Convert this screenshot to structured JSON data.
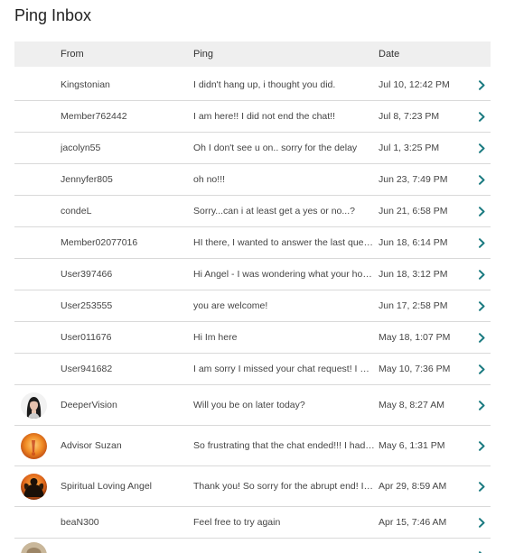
{
  "page": {
    "title": "Ping Inbox"
  },
  "colors": {
    "accent": "#1a7a80",
    "header_bg": "#efefef",
    "divider": "#d9d9d9"
  },
  "table": {
    "headers": {
      "from": "From",
      "ping": "Ping",
      "date": "Date"
    },
    "rows": [
      {
        "from": "Kingstonian",
        "ping": "I didn't hang up, i thought you did.",
        "date": "Jul 10, 12:42 PM",
        "avatar": ""
      },
      {
        "from": "Member762442",
        "ping": "I am here!! I did not end the chat!!",
        "date": "Jul 8, 7:23 PM",
        "avatar": ""
      },
      {
        "from": "jacolyn55",
        "ping": "Oh I don't see u on.. sorry for the delay",
        "date": "Jul 1, 3:25 PM",
        "avatar": ""
      },
      {
        "from": "Jennyfer805",
        "ping": "oh no!!!",
        "date": "Jun 23, 7:49 PM",
        "avatar": ""
      },
      {
        "from": "condeL",
        "ping": "Sorry...can i at least get a yes or no...?",
        "date": "Jun 21, 6:58 PM",
        "avatar": ""
      },
      {
        "from": "Member02077016",
        "ping": "HI there, I wanted to answer the last question you asked",
        "date": "Jun 18, 6:14 PM",
        "avatar": ""
      },
      {
        "from": "User397466",
        "ping": "Hi Angel - I was wondering what your hours are",
        "date": "Jun 18, 3:12 PM",
        "avatar": ""
      },
      {
        "from": "User253555",
        "ping": "you are welcome!",
        "date": "Jun 17, 2:58 PM",
        "avatar": ""
      },
      {
        "from": "User011676",
        "ping": "Hi Im here",
        "date": "May 18, 1:07 PM",
        "avatar": ""
      },
      {
        "from": "User941682",
        "ping": "I am sorry I missed your chat request! I was away",
        "date": "May 10, 7:36 PM",
        "avatar": ""
      },
      {
        "from": "DeeperVision",
        "ping": "Will you be on later today?",
        "date": "May 8, 8:27 AM",
        "avatar": "woman-portrait"
      },
      {
        "from": "Advisor Suzan",
        "ping": "So frustrating that the chat ended!!! I had more to say",
        "date": "May 6, 1:31 PM",
        "avatar": "orange-glow"
      },
      {
        "from": "Spiritual Loving Angel",
        "ping": "Thank you! So sorry for the abrupt end! I hope you",
        "date": "Apr 29, 8:59 AM",
        "avatar": "angel-silhouette"
      },
      {
        "from": "beaN300",
        "ping": "Feel free to try again",
        "date": "Apr 15, 7:46 AM",
        "avatar": ""
      }
    ]
  }
}
